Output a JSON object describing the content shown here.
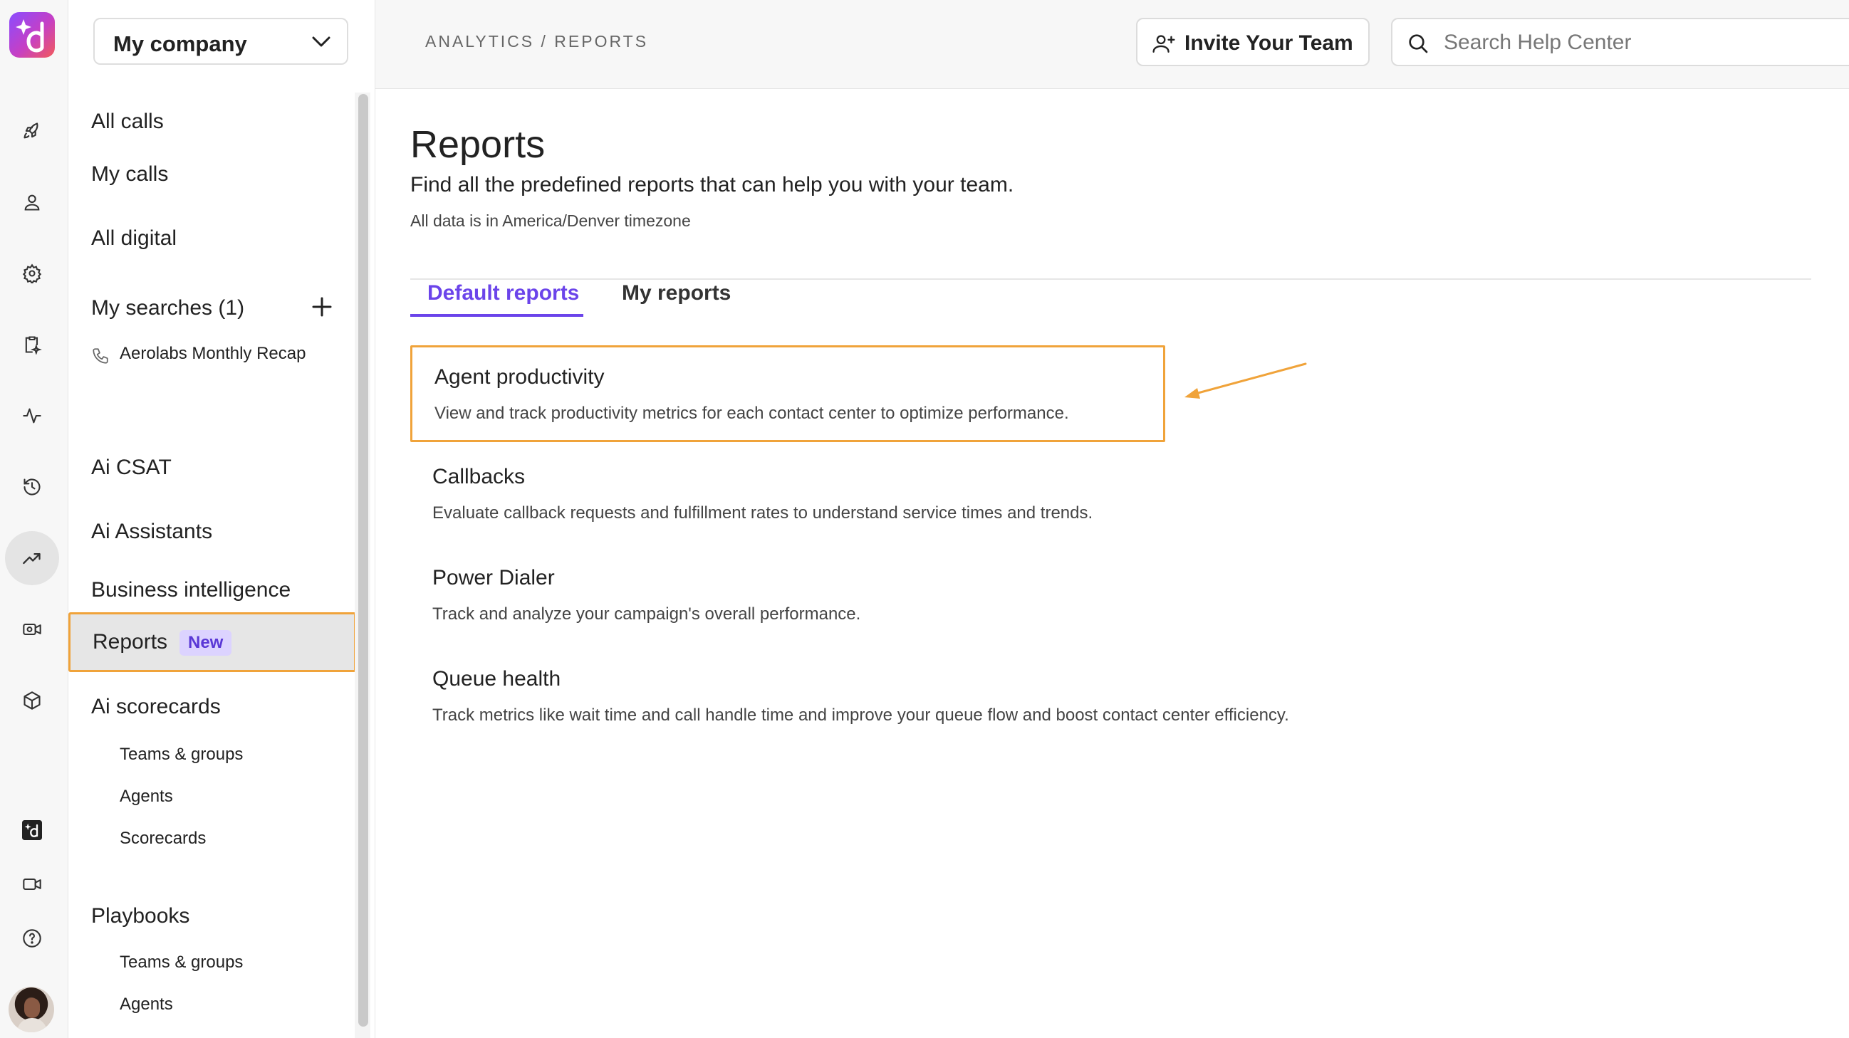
{
  "colors": {
    "accent": "#6b44ea",
    "highlight_orange": "#f0a33a",
    "badge_bg": "#dcd3ff"
  },
  "rail": {
    "logo": "dialpad-logo",
    "icons": [
      "rocket-icon",
      "person-icon",
      "gear-icon",
      "clipboard-sparkle-icon",
      "pulse-icon",
      "history-icon",
      "trending-up-icon",
      "camera-gear-icon",
      "cube-icon",
      "ai-d-icon",
      "video-icon",
      "help-icon"
    ],
    "active": "trending-up-icon"
  },
  "sidebar": {
    "company": "My company",
    "items": {
      "all_calls": "All calls",
      "my_calls": "My calls",
      "all_digital": "All digital",
      "my_searches": "My searches (1)",
      "recap": "Aerolabs Monthly Recap",
      "ai_csat": "Ai CSAT",
      "ai_assistants": "Ai Assistants",
      "business_intelligence": "Business intelligence",
      "reports": "Reports",
      "reports_badge": "New",
      "ai_scorecards": "Ai scorecards",
      "sc_teams": "Teams & groups",
      "sc_agents": "Agents",
      "sc_scorecards": "Scorecards",
      "playbooks": "Playbooks",
      "pb_teams": "Teams & groups",
      "pb_agents": "Agents"
    }
  },
  "header": {
    "breadcrumb": "ANALYTICS / REPORTS",
    "invite_label": "Invite Your Team",
    "search_placeholder": "Search Help Center"
  },
  "main": {
    "title": "Reports",
    "subtitle": "Find all the predefined reports that can help you with your team.",
    "timezone_note": "All data is in America/Denver timezone",
    "tabs": [
      {
        "label": "Default reports",
        "active": true
      },
      {
        "label": "My reports",
        "active": false
      }
    ],
    "reports": [
      {
        "title": "Agent productivity",
        "description": "View and track productivity metrics for each contact center to optimize performance."
      },
      {
        "title": "Callbacks",
        "description": "Evaluate callback requests and fulfillment rates to understand service times and trends."
      },
      {
        "title": "Power Dialer",
        "description": "Track and analyze your campaign's overall performance."
      },
      {
        "title": "Queue health",
        "description": "Track metrics like wait time and call handle time and improve your queue flow and boost contact center efficiency."
      }
    ]
  }
}
